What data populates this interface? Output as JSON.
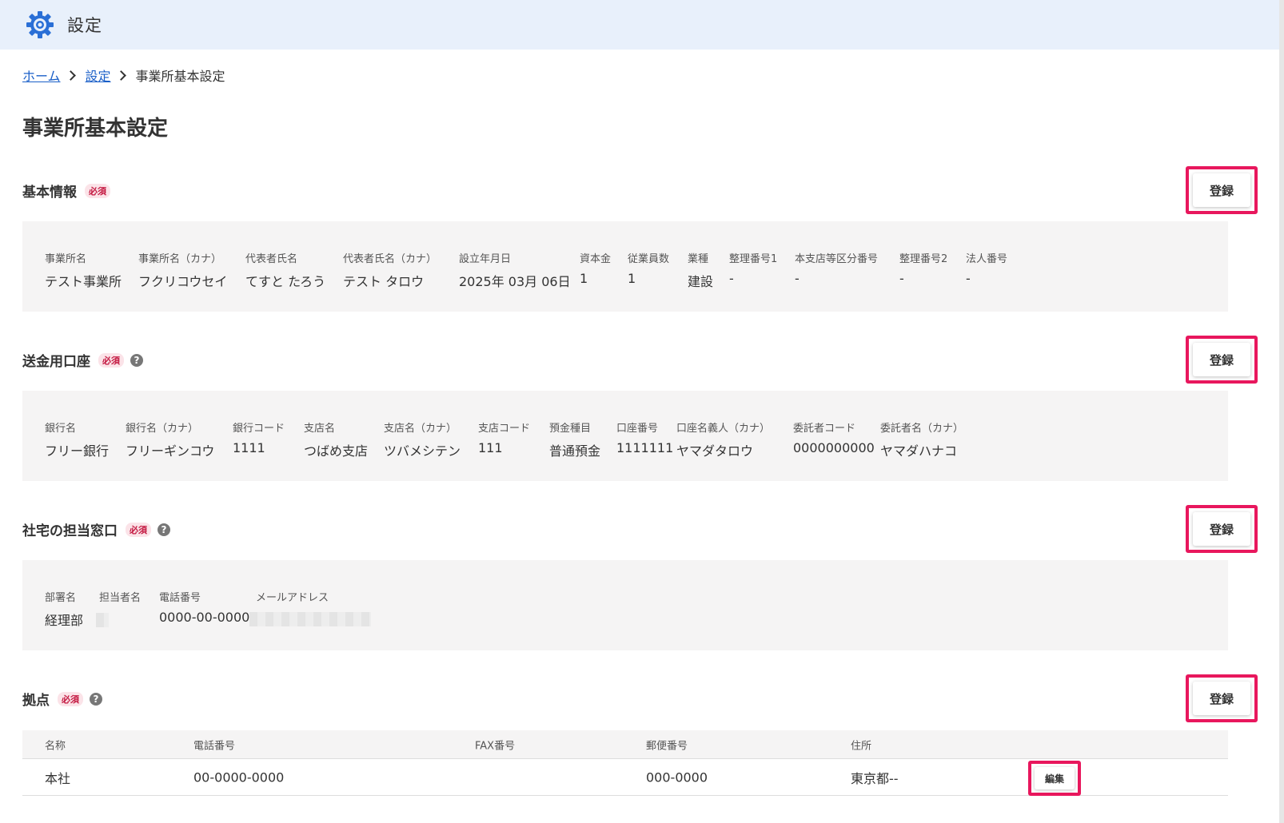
{
  "header": {
    "title": "設定",
    "icon": "gear-icon"
  },
  "breadcrumb": {
    "home": "ホーム",
    "settings": "設定",
    "current": "事業所基本設定"
  },
  "page_title": "事業所基本設定",
  "register_label": "登録",
  "required_label": "必須",
  "help_glyph": "?",
  "basic": {
    "title": "基本情報",
    "fields": [
      {
        "label": "事業所名",
        "value": "テスト事業所"
      },
      {
        "label": "事業所名（カナ）",
        "value": "フクリコウセイ"
      },
      {
        "label": "代表者氏名",
        "value": "てすと たろう"
      },
      {
        "label": "代表者氏名（カナ）",
        "value": "テスト タロウ"
      },
      {
        "label": "設立年月日",
        "value": "2025年 03月 06日"
      },
      {
        "label": "資本金",
        "value": "1"
      },
      {
        "label": "従業員数",
        "value": "1"
      },
      {
        "label": "業種",
        "value": "建設"
      },
      {
        "label": "整理番号1",
        "value": "-"
      },
      {
        "label": "本支店等区分番号",
        "value": "-"
      },
      {
        "label": "整理番号2",
        "value": "-"
      },
      {
        "label": "法人番号",
        "value": "-"
      }
    ]
  },
  "bank": {
    "title": "送金用口座",
    "fields": [
      {
        "label": "銀行名",
        "value": "フリー銀行"
      },
      {
        "label": "銀行名（カナ）",
        "value": "フリーギンコウ"
      },
      {
        "label": "銀行コード",
        "value": "1111"
      },
      {
        "label": "支店名",
        "value": "つばめ支店"
      },
      {
        "label": "支店名（カナ）",
        "value": "ツバメシテン"
      },
      {
        "label": "支店コード",
        "value": "111"
      },
      {
        "label": "預金種目",
        "value": "普通預金"
      },
      {
        "label": "口座番号",
        "value": "1111111"
      },
      {
        "label": "口座名義人（カナ）",
        "value": "ヤマダタロウ"
      },
      {
        "label": "委託者コード",
        "value": "0000000000"
      },
      {
        "label": "委託者名（カナ）",
        "value": "ヤマダハナコ"
      }
    ]
  },
  "contact": {
    "title": "社宅の担当窓口",
    "fields": [
      {
        "label": "部署名",
        "value": "経理部"
      },
      {
        "label": "担当者名",
        "value": ""
      },
      {
        "label": "電話番号",
        "value": "0000-00-0000"
      },
      {
        "label": "メールアドレス",
        "value": ""
      }
    ]
  },
  "bases": {
    "title": "拠点",
    "columns": [
      "名称",
      "電話番号",
      "FAX番号",
      "郵便番号",
      "住所"
    ],
    "rows": [
      {
        "name": "本社",
        "tel": "00-0000-0000",
        "fax": "",
        "zip": "000-0000",
        "address": "東京都--",
        "edit_label": "編集"
      }
    ]
  }
}
